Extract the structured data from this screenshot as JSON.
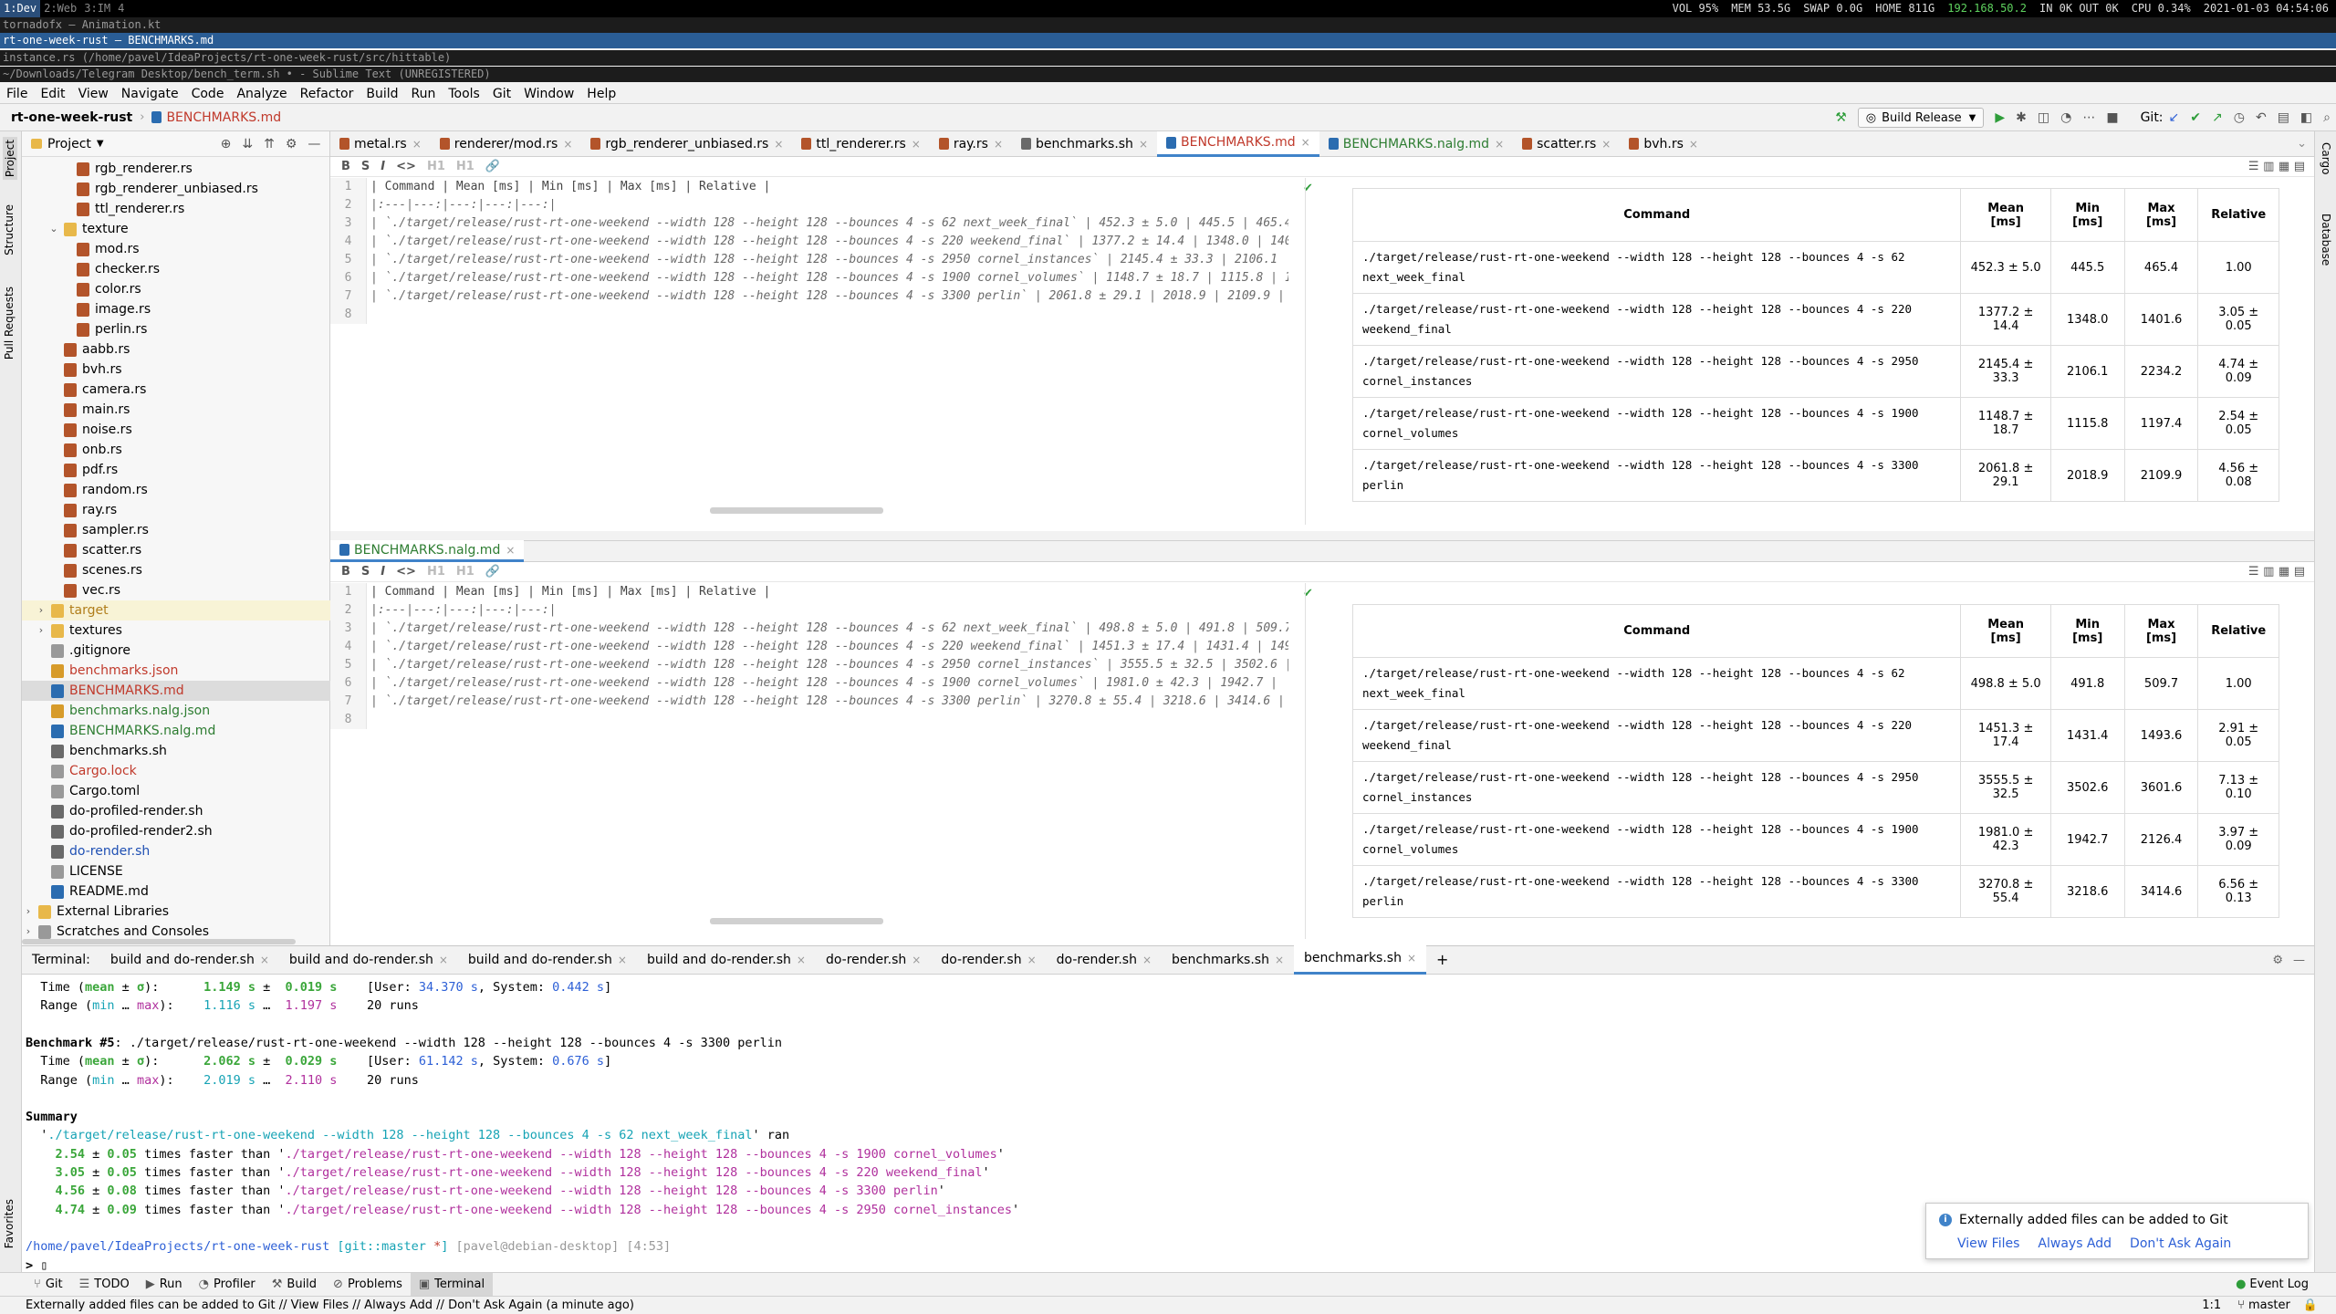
{
  "wm": {
    "workspaces": [
      "1:Dev",
      "2:Web",
      "3:IM",
      "4"
    ],
    "stats": [
      "VOL 95%",
      "MEM 53.5G",
      "SWAP 0.0G",
      "HOME 811G",
      "192.168.50.2",
      "IN 0K OUT 0K",
      "CPU 0.34%",
      "2021-01-03 04:54:06"
    ]
  },
  "windows": [
    "tornadofx – Animation.kt",
    "rt-one-week-rust – BENCHMARKS.md",
    "instance.rs (/home/pavel/IdeaProjects/rt-one-week-rust/src/hittable)",
    "~/Downloads/Telegram Desktop/bench_term.sh • - Sublime Text (UNREGISTERED)"
  ],
  "menu": [
    "File",
    "Edit",
    "View",
    "Navigate",
    "Code",
    "Analyze",
    "Refactor",
    "Build",
    "Run",
    "Tools",
    "Git",
    "Window",
    "Help"
  ],
  "nav": {
    "project": "rt-one-week-rust",
    "file": "BENCHMARKS.md",
    "run_config": "Build Release",
    "git_label": "Git:"
  },
  "sidebar": {
    "left_tabs": [
      "Project",
      "Structure",
      "Pull Requests",
      "Favorites"
    ],
    "right_tabs": [
      "Cargo",
      "Database"
    ]
  },
  "project": {
    "header": "Project",
    "items": [
      {
        "name": "rgb_renderer.rs",
        "type": "rs",
        "depth": 3
      },
      {
        "name": "rgb_renderer_unbiased.rs",
        "type": "rs",
        "depth": 3
      },
      {
        "name": "ttl_renderer.rs",
        "type": "rs",
        "depth": 3
      },
      {
        "name": "texture",
        "type": "dir",
        "depth": 2,
        "arrow": "⌄"
      },
      {
        "name": "mod.rs",
        "type": "rs",
        "depth": 3
      },
      {
        "name": "checker.rs",
        "type": "rs",
        "depth": 3
      },
      {
        "name": "color.rs",
        "type": "rs",
        "depth": 3
      },
      {
        "name": "image.rs",
        "type": "rs",
        "depth": 3
      },
      {
        "name": "perlin.rs",
        "type": "rs",
        "depth": 3
      },
      {
        "name": "aabb.rs",
        "type": "rs",
        "depth": 2
      },
      {
        "name": "bvh.rs",
        "type": "rs",
        "depth": 2
      },
      {
        "name": "camera.rs",
        "type": "rs",
        "depth": 2
      },
      {
        "name": "main.rs",
        "type": "rs",
        "depth": 2
      },
      {
        "name": "noise.rs",
        "type": "rs",
        "depth": 2
      },
      {
        "name": "onb.rs",
        "type": "rs",
        "depth": 2
      },
      {
        "name": "pdf.rs",
        "type": "rs",
        "depth": 2
      },
      {
        "name": "random.rs",
        "type": "rs",
        "depth": 2
      },
      {
        "name": "ray.rs",
        "type": "rs",
        "depth": 2
      },
      {
        "name": "sampler.rs",
        "type": "rs",
        "depth": 2
      },
      {
        "name": "scatter.rs",
        "type": "rs",
        "depth": 2
      },
      {
        "name": "scenes.rs",
        "type": "rs",
        "depth": 2
      },
      {
        "name": "vec.rs",
        "type": "rs",
        "depth": 2
      },
      {
        "name": "target",
        "type": "dir",
        "depth": 1,
        "arrow": "›",
        "color": "#b07d1a",
        "highlight": "#f8f3d6"
      },
      {
        "name": "textures",
        "type": "dir",
        "depth": 1,
        "arrow": "›"
      },
      {
        "name": ".gitignore",
        "type": "gen",
        "depth": 1
      },
      {
        "name": "benchmarks.json",
        "type": "js",
        "depth": 1,
        "color": "#c0392b"
      },
      {
        "name": "BENCHMARKS.md",
        "type": "md",
        "depth": 1,
        "color": "#c0392b",
        "highlight": "#dcdcdc"
      },
      {
        "name": "benchmarks.nalg.json",
        "type": "js",
        "depth": 1,
        "color": "#2e7d32"
      },
      {
        "name": "BENCHMARKS.nalg.md",
        "type": "md",
        "depth": 1,
        "color": "#2e7d32"
      },
      {
        "name": "benchmarks.sh",
        "type": "sh",
        "depth": 1
      },
      {
        "name": "Cargo.lock",
        "type": "gen",
        "depth": 1,
        "color": "#c0392b"
      },
      {
        "name": "Cargo.toml",
        "type": "gen",
        "depth": 1
      },
      {
        "name": "do-profiled-render.sh",
        "type": "sh",
        "depth": 1
      },
      {
        "name": "do-profiled-render2.sh",
        "type": "sh",
        "depth": 1
      },
      {
        "name": "do-render.sh",
        "type": "sh",
        "depth": 1,
        "color": "#1e4fb3"
      },
      {
        "name": "LICENSE",
        "type": "gen",
        "depth": 1
      },
      {
        "name": "README.md",
        "type": "md",
        "depth": 1
      },
      {
        "name": "External Libraries",
        "type": "dir",
        "depth": 0,
        "arrow": "›"
      },
      {
        "name": "Scratches and Consoles",
        "type": "gen",
        "depth": 0,
        "arrow": "›"
      }
    ]
  },
  "tabs": [
    {
      "label": "metal.rs",
      "type": "rs"
    },
    {
      "label": "renderer/mod.rs",
      "type": "rs"
    },
    {
      "label": "rgb_renderer_unbiased.rs",
      "type": "rs"
    },
    {
      "label": "ttl_renderer.rs",
      "type": "rs"
    },
    {
      "label": "ray.rs",
      "type": "rs"
    },
    {
      "label": "benchmarks.sh",
      "type": "sh"
    },
    {
      "label": "BENCHMARKS.md",
      "type": "md",
      "active": true,
      "color": "#c0392b"
    },
    {
      "label": "BENCHMARKS.nalg.md",
      "type": "md",
      "color": "#2e7d32"
    },
    {
      "label": "scatter.rs",
      "type": "rs"
    },
    {
      "label": "bvh.rs",
      "type": "rs"
    }
  ],
  "editor_toolbar": [
    "B",
    "S",
    "I",
    "<>",
    "H1",
    "H1",
    "🔗"
  ],
  "editor1": {
    "lines": [
      "| Command | Mean [ms] | Min [ms] | Max [ms] | Relative |",
      "|:---|---:|---:|---:|---:|",
      "| `./target/release/rust-rt-one-weekend --width 128 --height 128 --bounces 4 -s 62 next_week_final` | 452.3 ± 5.0 | 445.5 | 465.4",
      "| `./target/release/rust-rt-one-weekend --width 128 --height 128 --bounces 4 -s 220 weekend_final` | 1377.2 ± 14.4 | 1348.0 | 140",
      "| `./target/release/rust-rt-one-weekend --width 128 --height 128 --bounces 4 -s 2950 cornel_instances` | 2145.4 ± 33.3 | 2106.1",
      "| `./target/release/rust-rt-one-weekend --width 128 --height 128 --bounces 4 -s 1900 cornel_volumes` | 1148.7 ± 18.7 | 1115.8 | 1",
      "| `./target/release/rust-rt-one-weekend --width 128 --height 128 --bounces 4 -s 3300 perlin` | 2061.8 ± 29.1 | 2018.9 | 2109.9 |",
      ""
    ]
  },
  "editor2": {
    "tab": "BENCHMARKS.nalg.md",
    "lines": [
      "| Command | Mean [ms] | Min [ms] | Max [ms] | Relative |",
      "|:---|---:|---:|---:|---:|",
      "| `./target/release/rust-rt-one-weekend --width 128 --height 128 --bounces 4 -s 62 next_week_final` | 498.8 ± 5.0 | 491.8 | 509.7",
      "| `./target/release/rust-rt-one-weekend --width 128 --height 128 --bounces 4 -s 220 weekend_final` | 1451.3 ± 17.4 | 1431.4 | 149",
      "| `./target/release/rust-rt-one-weekend --width 128 --height 128 --bounces 4 -s 2950 cornel_instances` | 3555.5 ± 32.5 | 3502.6 |",
      "| `./target/release/rust-rt-one-weekend --width 128 --height 128 --bounces 4 -s 1900 cornel_volumes` | 1981.0 ± 42.3 | 1942.7 |",
      "| `./target/release/rust-rt-one-weekend --width 128 --height 128 --bounces 4 -s 3300 perlin` | 3270.8 ± 55.4 | 3218.6 | 3414.6 |",
      ""
    ]
  },
  "preview_headers": [
    "Command",
    "Mean [ms]",
    "Min [ms]",
    "Max [ms]",
    "Relative"
  ],
  "preview1": [
    {
      "cmd": "./target/release/rust-rt-one-weekend --width 128 --height 128 --bounces 4 -s 62 next_week_final",
      "mean": "452.3 ± 5.0",
      "min": "445.5",
      "max": "465.4",
      "rel": "1.00"
    },
    {
      "cmd": "./target/release/rust-rt-one-weekend --width 128 --height 128 --bounces 4 -s 220 weekend_final",
      "mean": "1377.2 ± 14.4",
      "min": "1348.0",
      "max": "1401.6",
      "rel": "3.05 ± 0.05"
    },
    {
      "cmd": "./target/release/rust-rt-one-weekend --width 128 --height 128 --bounces 4 -s 2950 cornel_instances",
      "mean": "2145.4 ± 33.3",
      "min": "2106.1",
      "max": "2234.2",
      "rel": "4.74 ± 0.09"
    },
    {
      "cmd": "./target/release/rust-rt-one-weekend --width 128 --height 128 --bounces 4 -s 1900 cornel_volumes",
      "mean": "1148.7 ± 18.7",
      "min": "1115.8",
      "max": "1197.4",
      "rel": "2.54 ± 0.05"
    },
    {
      "cmd": "./target/release/rust-rt-one-weekend --width 128 --height 128 --bounces 4 -s 3300 perlin",
      "mean": "2061.8 ± 29.1",
      "min": "2018.9",
      "max": "2109.9",
      "rel": "4.56 ± 0.08"
    }
  ],
  "preview2": [
    {
      "cmd": "./target/release/rust-rt-one-weekend --width 128 --height 128 --bounces 4 -s 62 next_week_final",
      "mean": "498.8 ± 5.0",
      "min": "491.8",
      "max": "509.7",
      "rel": "1.00"
    },
    {
      "cmd": "./target/release/rust-rt-one-weekend --width 128 --height 128 --bounces 4 -s 220 weekend_final",
      "mean": "1451.3 ± 17.4",
      "min": "1431.4",
      "max": "1493.6",
      "rel": "2.91 ± 0.05"
    },
    {
      "cmd": "./target/release/rust-rt-one-weekend --width 128 --height 128 --bounces 4 -s 2950 cornel_instances",
      "mean": "3555.5 ± 32.5",
      "min": "3502.6",
      "max": "3601.6",
      "rel": "7.13 ± 0.10"
    },
    {
      "cmd": "./target/release/rust-rt-one-weekend --width 128 --height 128 --bounces 4 -s 1900 cornel_volumes",
      "mean": "1981.0 ± 42.3",
      "min": "1942.7",
      "max": "2126.4",
      "rel": "3.97 ± 0.09"
    },
    {
      "cmd": "./target/release/rust-rt-one-weekend --width 128 --height 128 --bounces 4 -s 3300 perlin",
      "mean": "3270.8 ± 55.4",
      "min": "3218.6",
      "max": "3414.6",
      "rel": "6.56 ± 0.13"
    }
  ],
  "terminal": {
    "label": "Terminal:",
    "tabs": [
      "build and do-render.sh",
      "build and do-render.sh",
      "build and do-render.sh",
      "build and do-render.sh",
      "do-render.sh",
      "do-render.sh",
      "do-render.sh",
      "benchmarks.sh",
      "benchmarks.sh"
    ],
    "active_tab": 8,
    "lines": [
      [
        {
          "t": "  Time ("
        },
        {
          "t": "mean",
          "c": "g"
        },
        {
          "t": " ± "
        },
        {
          "t": "σ",
          "c": "g"
        },
        {
          "t": "):      "
        },
        {
          "t": "1.149 s",
          "c": "g"
        },
        {
          "t": " ±  "
        },
        {
          "t": "0.019 s",
          "c": "g"
        },
        {
          "t": "    [User: "
        },
        {
          "t": "34.370 s",
          "c": "bl"
        },
        {
          "t": ", System: "
        },
        {
          "t": "0.442 s",
          "c": "bl"
        },
        {
          "t": "]"
        }
      ],
      [
        {
          "t": "  Range ("
        },
        {
          "t": "min",
          "c": "cy"
        },
        {
          "t": " … "
        },
        {
          "t": "max",
          "c": "mg"
        },
        {
          "t": "):    "
        },
        {
          "t": "1.116 s",
          "c": "cy"
        },
        {
          "t": " …  "
        },
        {
          "t": "1.197 s",
          "c": "mg"
        },
        {
          "t": "    20 runs"
        }
      ],
      [],
      [
        {
          "t": "Benchmark #5",
          "c": "b"
        },
        {
          "t": ": ./target/release/rust-rt-one-weekend --width 128 --height 128 --bounces 4 -s 3300 perlin"
        }
      ],
      [
        {
          "t": "  Time ("
        },
        {
          "t": "mean",
          "c": "g"
        },
        {
          "t": " ± "
        },
        {
          "t": "σ",
          "c": "g"
        },
        {
          "t": "):      "
        },
        {
          "t": "2.062 s",
          "c": "g"
        },
        {
          "t": " ±  "
        },
        {
          "t": "0.029 s",
          "c": "g"
        },
        {
          "t": "    [User: "
        },
        {
          "t": "61.142 s",
          "c": "bl"
        },
        {
          "t": ", System: "
        },
        {
          "t": "0.676 s",
          "c": "bl"
        },
        {
          "t": "]"
        }
      ],
      [
        {
          "t": "  Range ("
        },
        {
          "t": "min",
          "c": "cy"
        },
        {
          "t": " … "
        },
        {
          "t": "max",
          "c": "mg"
        },
        {
          "t": "):    "
        },
        {
          "t": "2.019 s",
          "c": "cy"
        },
        {
          "t": " …  "
        },
        {
          "t": "2.110 s",
          "c": "mg"
        },
        {
          "t": "    20 runs"
        }
      ],
      [],
      [
        {
          "t": "Summary",
          "c": "b"
        }
      ],
      [
        {
          "t": "  '"
        },
        {
          "t": "./target/release/rust-rt-one-weekend --width 128 --height 128 --bounces 4 -s 62 next_week_final",
          "c": "cy"
        },
        {
          "t": "' ran"
        }
      ],
      [
        {
          "t": "    "
        },
        {
          "t": "2.54",
          "c": "g"
        },
        {
          "t": " ± "
        },
        {
          "t": "0.05",
          "c": "g"
        },
        {
          "t": " times faster than '"
        },
        {
          "t": "./target/release/rust-rt-one-weekend --width 128 --height 128 --bounces 4 -s 1900 cornel_volumes",
          "c": "mg"
        },
        {
          "t": "'"
        }
      ],
      [
        {
          "t": "    "
        },
        {
          "t": "3.05",
          "c": "g"
        },
        {
          "t": " ± "
        },
        {
          "t": "0.05",
          "c": "g"
        },
        {
          "t": " times faster than '"
        },
        {
          "t": "./target/release/rust-rt-one-weekend --width 128 --height 128 --bounces 4 -s 220 weekend_final",
          "c": "mg"
        },
        {
          "t": "'"
        }
      ],
      [
        {
          "t": "    "
        },
        {
          "t": "4.56",
          "c": "g"
        },
        {
          "t": " ± "
        },
        {
          "t": "0.08",
          "c": "g"
        },
        {
          "t": " times faster than '"
        },
        {
          "t": "./target/release/rust-rt-one-weekend --width 128 --height 128 --bounces 4 -s 3300 perlin",
          "c": "mg"
        },
        {
          "t": "'"
        }
      ],
      [
        {
          "t": "    "
        },
        {
          "t": "4.74",
          "c": "g"
        },
        {
          "t": " ± "
        },
        {
          "t": "0.09",
          "c": "g"
        },
        {
          "t": " times faster than '"
        },
        {
          "t": "./target/release/rust-rt-one-weekend --width 128 --height 128 --bounces 4 -s 2950 cornel_instances",
          "c": "mg"
        },
        {
          "t": "'"
        }
      ],
      [],
      [
        {
          "t": "/home/pavel/IdeaProjects/rt-one-week-rust",
          "c": "bl"
        },
        {
          "t": " "
        },
        {
          "t": "[git::master ",
          "c": "cy"
        },
        {
          "t": "*",
          "c": "r"
        },
        {
          "t": "]",
          "c": "cy"
        },
        {
          "t": " [pavel@debian-desktop] [4:53]",
          "c": "gr"
        }
      ],
      [
        {
          "t": "> ",
          "c": "b"
        },
        {
          "t": "▯"
        }
      ]
    ]
  },
  "notification": {
    "text": "Externally added files can be added to Git",
    "actions": [
      "View Files",
      "Always Add",
      "Don't Ask Again"
    ]
  },
  "bottom_tools": [
    {
      "label": "Git",
      "icon": "⑂"
    },
    {
      "label": "TODO",
      "icon": "☰"
    },
    {
      "label": "Run",
      "icon": "▶"
    },
    {
      "label": "Profiler",
      "icon": "◔"
    },
    {
      "label": "Build",
      "icon": "⚒"
    },
    {
      "label": "Problems",
      "icon": "⊘"
    },
    {
      "label": "Terminal",
      "icon": "▣",
      "active": true
    }
  ],
  "event_log": "Event Log",
  "status": {
    "message": "Externally added files can be added to Git // View Files // Always Add // Don't Ask Again (a minute ago)",
    "position": "1:1",
    "branch": "master"
  },
  "colors": {
    "accent": "#4083c9",
    "ip": "#5fd35f"
  }
}
